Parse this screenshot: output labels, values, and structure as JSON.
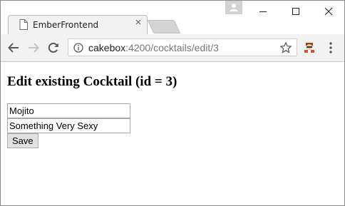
{
  "browser": {
    "tab": {
      "title": "EmberFrontend"
    },
    "address_bar": {
      "host": "cakebox",
      "path": ":4200/cocktails/edit/3"
    }
  },
  "page": {
    "heading": "Edit existing Cocktail (id = 3)",
    "form": {
      "name_value": "Mojito",
      "description_value": "Something Very Sexy",
      "save_label": "Save"
    }
  }
}
